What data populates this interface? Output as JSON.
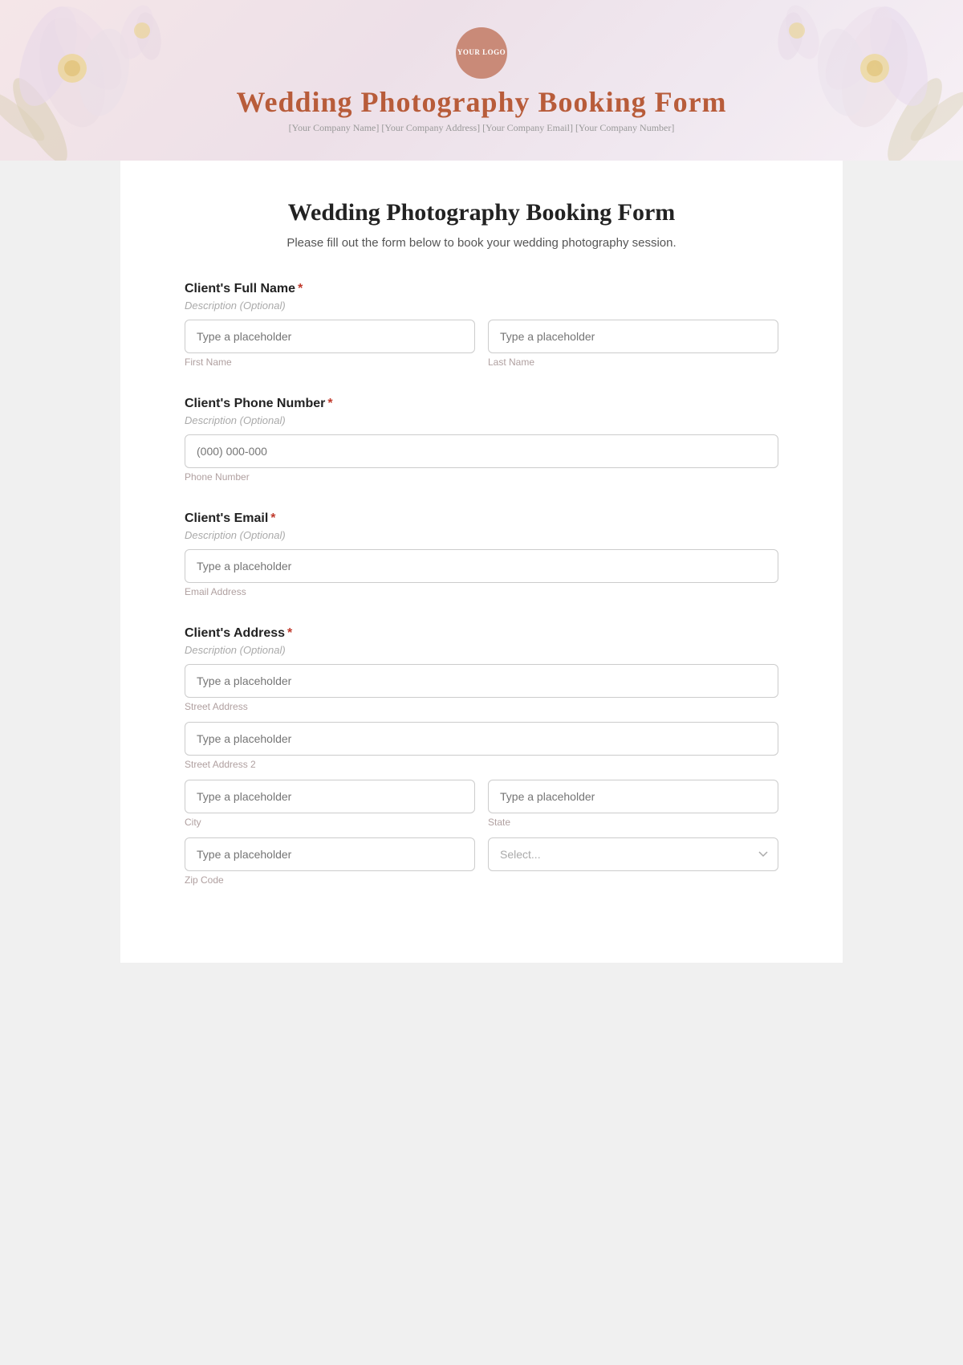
{
  "header": {
    "logo_text": "YOUR\nLOGO",
    "title": "Wedding Photography Booking Form",
    "subtitle": "[Your Company Name] [Your Company Address] [Your Company Email] [Your Company Number]"
  },
  "form": {
    "title": "Wedding Photography Booking Form",
    "description": "Please fill out the form below to book your wedding photography session.",
    "fields": [
      {
        "id": "full-name",
        "label": "Client's Full Name",
        "required": true,
        "description": "Description (Optional)",
        "inputs": [
          {
            "placeholder": "Type a placeholder",
            "sub_label": "First Name"
          },
          {
            "placeholder": "Type a placeholder",
            "sub_label": "Last Name"
          }
        ]
      },
      {
        "id": "phone",
        "label": "Client's Phone Number",
        "required": true,
        "description": "Description (Optional)",
        "inputs": [
          {
            "placeholder": "(000) 000-000",
            "sub_label": "Phone Number"
          }
        ]
      },
      {
        "id": "email",
        "label": "Client's Email",
        "required": true,
        "description": "Description (Optional)",
        "inputs": [
          {
            "placeholder": "Type a placeholder",
            "sub_label": "Email Address"
          }
        ]
      },
      {
        "id": "address",
        "label": "Client's Address",
        "required": true,
        "description": "Description (Optional)",
        "rows": [
          {
            "inputs": [
              {
                "placeholder": "Type a placeholder",
                "sub_label": "Street Address",
                "full": true
              }
            ]
          },
          {
            "inputs": [
              {
                "placeholder": "Type a placeholder",
                "sub_label": "Street Address 2",
                "full": true
              }
            ]
          },
          {
            "inputs": [
              {
                "placeholder": "Type a placeholder",
                "sub_label": "City"
              },
              {
                "placeholder": "Type a placeholder",
                "sub_label": "State"
              }
            ]
          },
          {
            "inputs": [
              {
                "placeholder": "Type a placeholder",
                "sub_label": "Zip Code"
              },
              {
                "placeholder": "Select...",
                "sub_label": "",
                "type": "select"
              }
            ]
          }
        ]
      }
    ]
  }
}
